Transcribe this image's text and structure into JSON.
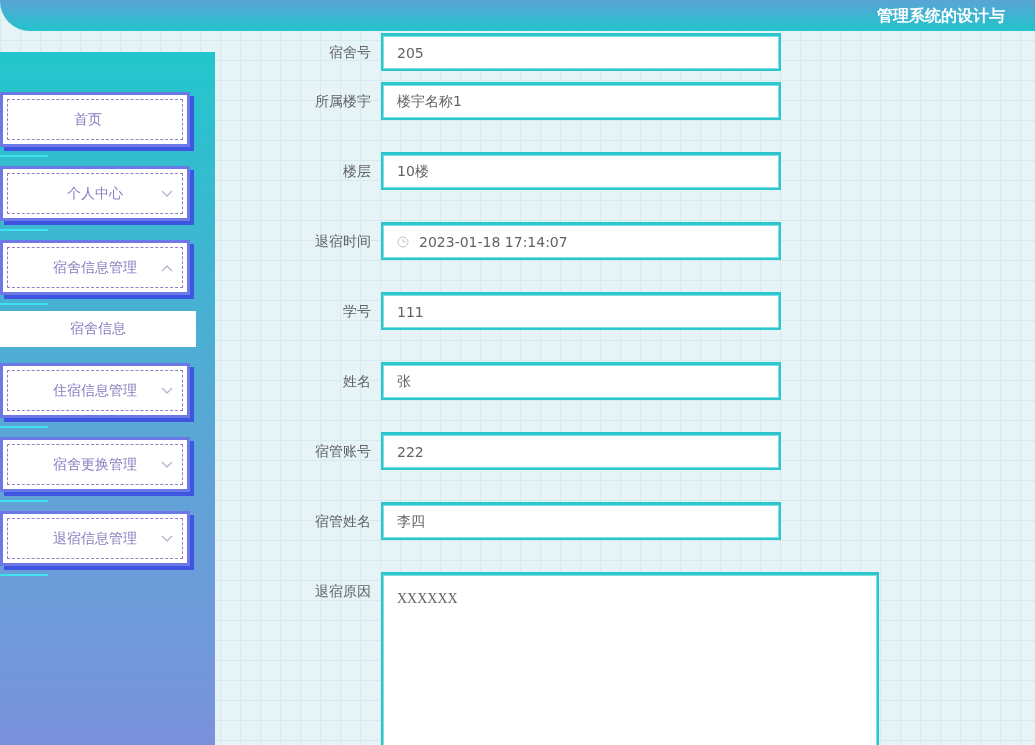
{
  "header": {
    "title": "管理系统的设计与"
  },
  "menu": [
    {
      "label": "首页",
      "kind": "link"
    },
    {
      "label": "个人中心",
      "kind": "submenu",
      "expanded": false
    },
    {
      "label": "宿舍信息管理",
      "kind": "submenu",
      "expanded": true,
      "children": [
        {
          "label": "宿舍信息",
          "selected": true
        }
      ]
    },
    {
      "label": "住宿信息管理",
      "kind": "submenu",
      "expanded": false
    },
    {
      "label": "宿舍更换管理",
      "kind": "submenu",
      "expanded": false
    },
    {
      "label": "退宿信息管理",
      "kind": "submenu",
      "expanded": false
    }
  ],
  "form": [
    {
      "label": "宿舍号",
      "kind": "text",
      "value": "205"
    },
    {
      "label": "所属楼宇",
      "kind": "text",
      "value": "楼宇名称1"
    },
    {
      "label": "楼层",
      "kind": "text",
      "value": "10楼"
    },
    {
      "label": "退宿时间",
      "kind": "datetime",
      "value": "2023-01-18 17:14:07"
    },
    {
      "label": "学号",
      "kind": "text",
      "value": "111"
    },
    {
      "label": "姓名",
      "kind": "text",
      "value": "张"
    },
    {
      "label": "宿管账号",
      "kind": "text",
      "value": "222"
    },
    {
      "label": "宿管姓名",
      "kind": "text",
      "value": "李四"
    },
    {
      "label": "退宿原因",
      "kind": "textarea",
      "value": "XXXXXX"
    }
  ]
}
